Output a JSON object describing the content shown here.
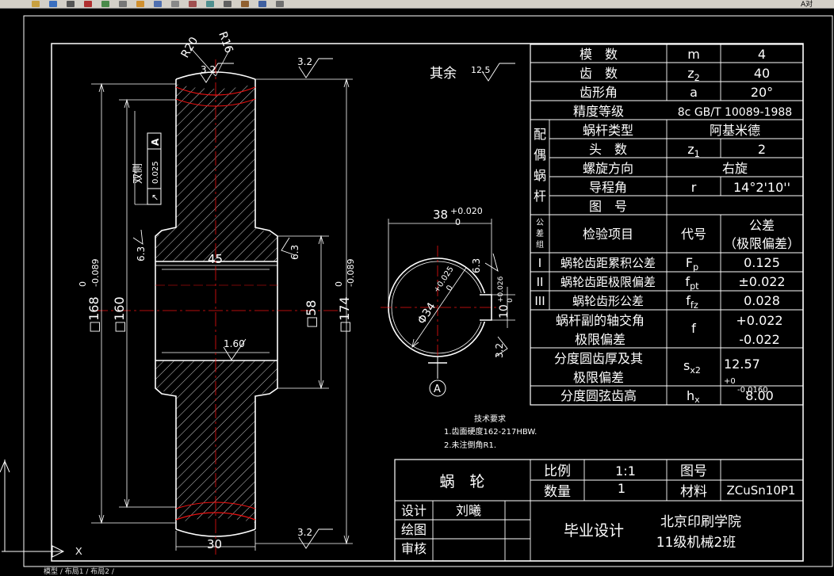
{
  "toolbar": {
    "right_label": "A对",
    "icons": [
      "open-icon",
      "save-icon",
      "print-icon",
      "cut-icon",
      "copy-icon",
      "paste-icon",
      "undo-icon",
      "redo-icon",
      "zoom-icon",
      "pan-icon",
      "layer-icon",
      "properties-icon",
      "text-style-icon",
      "dim-style-icon",
      "table-style-icon"
    ]
  },
  "status": {
    "tabs_text": "模型 / 布局1 / 布局2 /"
  },
  "drawing": {
    "surface_finish_note": "其余",
    "surface_finish_default": "12.5",
    "roughness_values": {
      "top1": "3.2",
      "top2": "3.2",
      "left": "6.3",
      "right": "6.3",
      "bore": "1.60",
      "bottom": "3.2",
      "section_a": "6.3",
      "section_b": "3.2"
    },
    "radii": {
      "r20": "R20",
      "r16": "R16"
    },
    "dims": {
      "d168": "□168",
      "d168_tol_upper": "0",
      "d168_tol_lower": "-0.089",
      "d160": "□160",
      "d45": "45",
      "d58": "□58",
      "d174": "□174",
      "d174_tol_upper": "0",
      "d174_tol_lower": "-0.089",
      "d30": "30",
      "bore_width": "38",
      "bore_width_tol_upper": "+0.020",
      "bore_width_tol_lower": "0",
      "bore_diam": "Φ34",
      "bore_diam_tol_upper": "+0.025",
      "bore_diam_tol_lower": "0",
      "key_width": "10",
      "key_tol_upper": "+0.026",
      "key_tol_lower": "0"
    },
    "tolerance_frame": {
      "side_label": "双侧",
      "symbol": "↗",
      "value": "0.025",
      "datum": "A"
    },
    "datum_label": "A",
    "tech_requirements": {
      "title": "技术要求",
      "items": [
        "1.齿面硬度162-217HBW.",
        "2.未注倒角R1."
      ]
    }
  },
  "params_table": {
    "rows": [
      {
        "name": "模　数",
        "symbol": "m",
        "sub": "",
        "value": "4"
      },
      {
        "name": "齿　数",
        "symbol": "z",
        "sub": "2",
        "value": "40"
      },
      {
        "name": "齿形角",
        "symbol": "a",
        "sub": "",
        "value": "20°"
      },
      {
        "name": "精度等级",
        "symbol": "",
        "sub": "",
        "value": "8c GB/T 10089-1988"
      }
    ],
    "mating_label": [
      "配",
      "偶",
      "蜗",
      "杆"
    ],
    "mating_rows": [
      {
        "name": "蜗杆类型",
        "symbol": "",
        "sub": "",
        "value": "阿基米德"
      },
      {
        "name": "头　数",
        "symbol": "z",
        "sub": "1",
        "value": "2"
      },
      {
        "name": "螺旋方向",
        "symbol": "",
        "sub": "",
        "value": "右旋"
      },
      {
        "name": "导程角",
        "symbol": "r",
        "sub": "",
        "value": "14°2'10''"
      },
      {
        "name": "图　号",
        "symbol": "",
        "sub": "",
        "value": ""
      }
    ],
    "inspection_header": {
      "group": [
        "公",
        "差",
        "组"
      ],
      "item": "检验项目",
      "code": "代号",
      "tol1": "公差",
      "tol2": "（极限偏差）"
    },
    "inspection_rows": [
      {
        "group": "I",
        "name": "蜗轮齿距累积公差",
        "symbol": "F",
        "sub": "p",
        "value": "0.125"
      },
      {
        "group": "II",
        "name": "蜗轮齿距极限偏差",
        "symbol": "f",
        "sub": "pt",
        "value": "±0.022"
      },
      {
        "group": "III",
        "name": "蜗轮齿形公差",
        "symbol": "f",
        "sub": "fz",
        "value": "0.028"
      }
    ],
    "axis_row": {
      "name1": "蜗杆副的轴交角",
      "name2": "极限偏差",
      "symbol": "f",
      "value1": "+0.022",
      "value2": "-0.022"
    },
    "thickness_row": {
      "name1": "分度圆齿厚及其",
      "name2": "极限偏差",
      "symbol": "s",
      "sub": "x2",
      "value": "12.57",
      "tol_upper": "+0",
      "tol_lower": "-0.0160"
    },
    "chord_row": {
      "name": "分度圆弦齿高",
      "symbol": "h",
      "sub": "x",
      "value": "8.00"
    }
  },
  "title_block": {
    "part_name": "蜗　轮",
    "scale_label": "比例",
    "scale_value": "1:1",
    "drawing_no_label": "图号",
    "drawing_no_value": "",
    "qty_label": "数量",
    "qty_value": "1",
    "material_label": "材料",
    "material_value": "ZCuSn10P1",
    "design_label": "设计",
    "designer": "刘曦",
    "draw_label": "绘图",
    "check_label": "审核",
    "project": "毕业设计",
    "school": "北京印刷学院",
    "class_name": "11级机械2班"
  }
}
